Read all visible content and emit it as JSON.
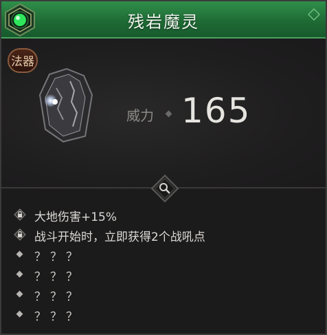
{
  "header": {
    "title": "残岩魔灵"
  },
  "item": {
    "type_label": "法器",
    "stat_label": "威力",
    "stat_value": "165"
  },
  "affixes": [
    {
      "text": "大地伤害+15%",
      "icon": "lock-icon"
    },
    {
      "text": "战斗开始时，立即获得2个战吼点",
      "icon": "lock-icon"
    },
    {
      "text": "？？？",
      "icon": "diamond-bullet-icon"
    },
    {
      "text": "？？？",
      "icon": "diamond-bullet-icon"
    },
    {
      "text": "？？？",
      "icon": "diamond-bullet-icon"
    },
    {
      "text": "？？？",
      "icon": "diamond-bullet-icon"
    }
  ],
  "colors": {
    "header_green": "#1f6b35",
    "panel_bg": "#1c1b1c",
    "badge_red": "#4a2417",
    "gem_green": "#3cff6a"
  }
}
